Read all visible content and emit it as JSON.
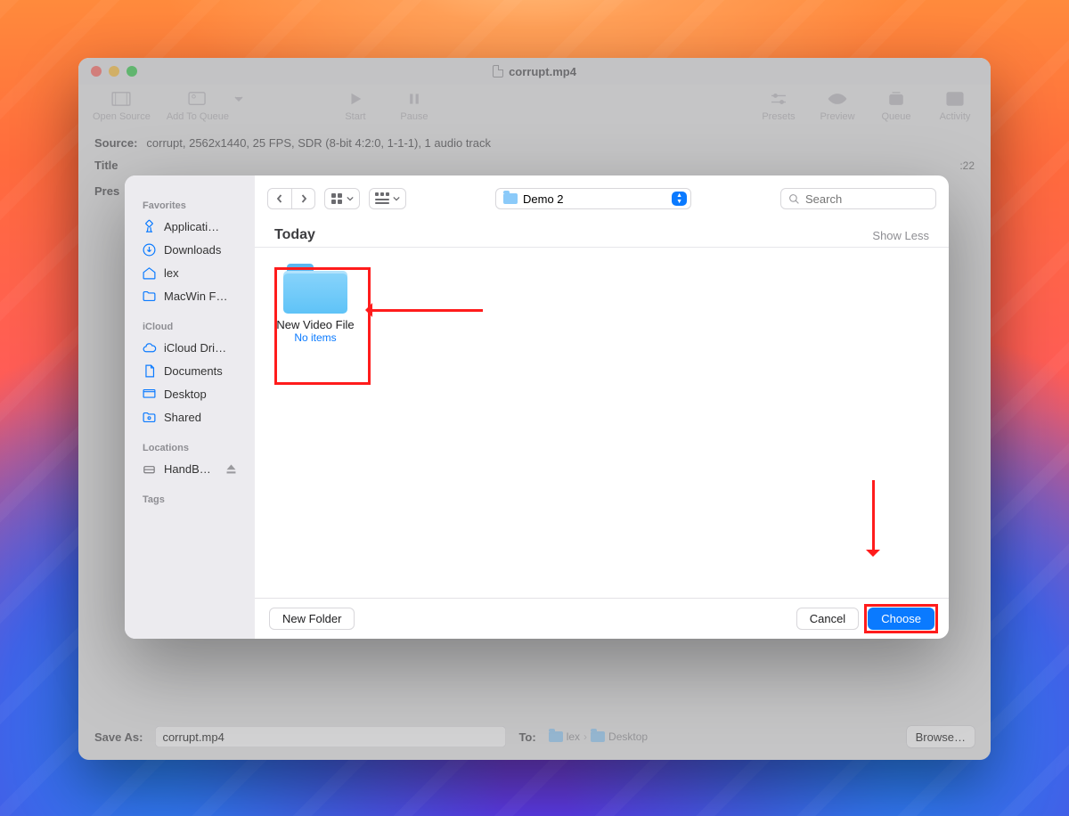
{
  "window": {
    "title": "corrupt.mp4",
    "source_label": "Source:",
    "source_info": "corrupt, 2562x1440, 25 FPS, SDR (8-bit 4:2:0, 1-1-1), 1 audio track",
    "title_label": "Title",
    "preset_label": "Pres",
    "duration_fragment": ":22",
    "save_as_label": "Save As:",
    "save_as_value": "corrupt.mp4",
    "to_label": "To:",
    "to_crumbs": [
      "lex",
      "Desktop"
    ],
    "browse_label": "Browse…"
  },
  "toolbar": {
    "open_source": "Open Source",
    "add_to_queue": "Add To Queue",
    "start": "Start",
    "pause": "Pause",
    "presets": "Presets",
    "preview": "Preview",
    "queue": "Queue",
    "activity": "Activity"
  },
  "chooser": {
    "sidebar": {
      "favorites_label": "Favorites",
      "favorites": [
        {
          "icon": "app",
          "label": "Applicati…"
        },
        {
          "icon": "download",
          "label": "Downloads"
        },
        {
          "icon": "home",
          "label": "lex"
        },
        {
          "icon": "folder",
          "label": "MacWin F…"
        }
      ],
      "icloud_label": "iCloud",
      "icloud": [
        {
          "icon": "cloud",
          "label": "iCloud Dri…"
        },
        {
          "icon": "doc",
          "label": "Documents"
        },
        {
          "icon": "desktop",
          "label": "Desktop"
        },
        {
          "icon": "shared",
          "label": "Shared"
        }
      ],
      "locations_label": "Locations",
      "locations": [
        {
          "icon": "disk",
          "label": "HandB…",
          "eject": true
        }
      ],
      "tags_label": "Tags"
    },
    "location": "Demo 2",
    "search_placeholder": "Search",
    "section_title": "Today",
    "show_less": "Show Less",
    "folder": {
      "name": "New Video File",
      "meta": "No items"
    },
    "footer": {
      "new_folder": "New Folder",
      "cancel": "Cancel",
      "choose": "Choose"
    }
  }
}
